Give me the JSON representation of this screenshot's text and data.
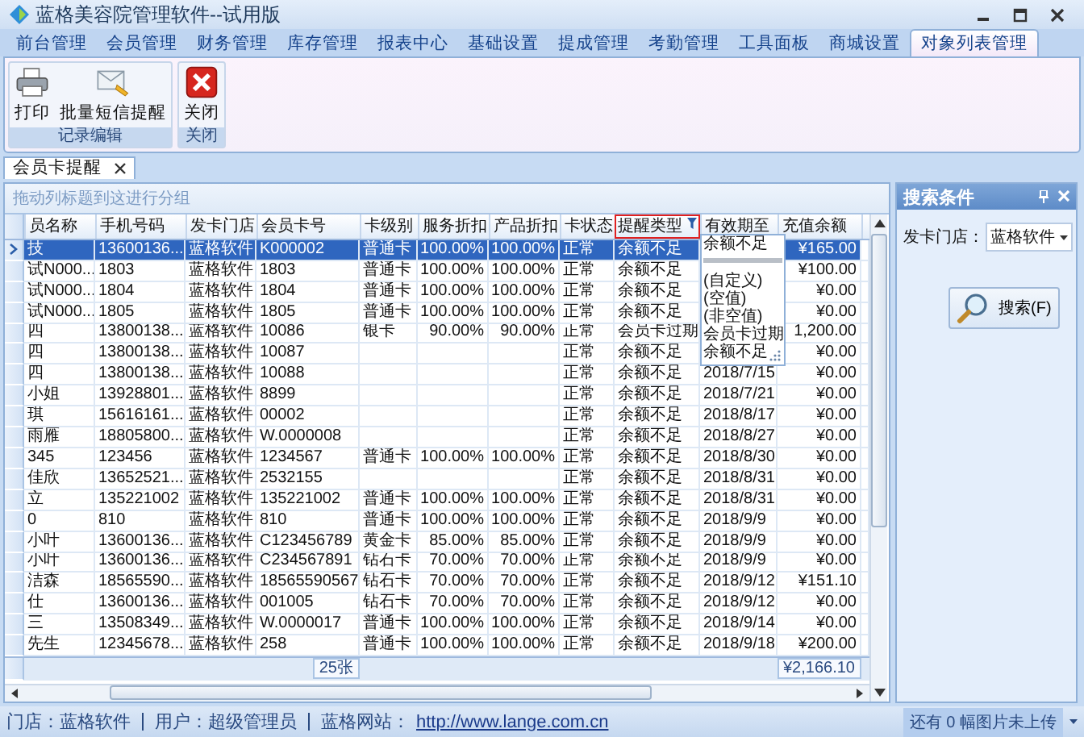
{
  "window": {
    "title": "蓝格美容院管理软件--试用版"
  },
  "tabs": [
    {
      "label": "前台管理",
      "selected": false
    },
    {
      "label": "会员管理",
      "selected": false
    },
    {
      "label": "财务管理",
      "selected": false
    },
    {
      "label": "库存管理",
      "selected": false
    },
    {
      "label": "报表中心",
      "selected": false
    },
    {
      "label": "基础设置",
      "selected": false
    },
    {
      "label": "提成管理",
      "selected": false
    },
    {
      "label": "考勤管理",
      "selected": false
    },
    {
      "label": "工具面板",
      "selected": false
    },
    {
      "label": "商城设置",
      "selected": false
    },
    {
      "label": "对象列表管理",
      "selected": true
    }
  ],
  "ribbon": [
    {
      "title": "记录编辑",
      "buttons": [
        {
          "label": "打印",
          "kind": "print"
        },
        {
          "label": "批量短信提醒",
          "kind": "sms"
        }
      ]
    },
    {
      "title": "关闭",
      "buttons": [
        {
          "label": "关闭",
          "kind": "close"
        }
      ]
    }
  ],
  "document_tab": {
    "label": "会员卡提醒"
  },
  "grid": {
    "group_hint": "拖动列标题到这进行分组",
    "columns": [
      {
        "label": "员名称",
        "filtered": false
      },
      {
        "label": "手机号码",
        "filtered": false
      },
      {
        "label": "发卡门店",
        "filtered": false
      },
      {
        "label": "会员卡号",
        "filtered": false
      },
      {
        "label": "卡级别",
        "filtered": false
      },
      {
        "label": "服务折扣",
        "filtered": false
      },
      {
        "label": "产品折扣",
        "filtered": false
      },
      {
        "label": "卡状态",
        "filtered": false
      },
      {
        "label": "提醒类型",
        "filtered": true
      },
      {
        "label": "有效期至",
        "filtered": false
      },
      {
        "label": "充值余额",
        "filtered": false
      }
    ],
    "rows": [
      {
        "selected": true,
        "name": "技",
        "phone": "13600136...",
        "store": "蓝格软件",
        "card_no": "K000002",
        "card_level": "普通卡",
        "service_discount": "100.00%",
        "product_discount": "100.00%",
        "card_status": "正常",
        "reminder_type": "余额不足",
        "balance": "¥165.00"
      },
      {
        "selected": false,
        "name": "试N000...",
        "phone": "1803",
        "store": "蓝格软件",
        "card_no": "1803",
        "card_level": "普通卡",
        "service_discount": "100.00%",
        "product_discount": "100.00%",
        "card_status": "正常",
        "reminder_type": "余额不足",
        "balance": "¥100.00"
      },
      {
        "selected": false,
        "name": "试N000...",
        "phone": "1804",
        "store": "蓝格软件",
        "card_no": "1804",
        "card_level": "普通卡",
        "service_discount": "100.00%",
        "product_discount": "100.00%",
        "card_status": "正常",
        "reminder_type": "余额不足",
        "balance": "¥0.00"
      },
      {
        "selected": false,
        "name": "试N000...",
        "phone": "1805",
        "store": "蓝格软件",
        "card_no": "1805",
        "card_level": "普通卡",
        "service_discount": "100.00%",
        "product_discount": "100.00%",
        "card_status": "正常",
        "reminder_type": "余额不足",
        "balance": "¥0.00"
      },
      {
        "selected": false,
        "name": "四",
        "phone": "13800138...",
        "store": "蓝格软件",
        "card_no": "10086",
        "card_level": "银卡",
        "service_discount": "90.00%",
        "product_discount": "90.00%",
        "card_status": "正常",
        "reminder_type": "会员卡过期",
        "balance": "1,200.00"
      },
      {
        "selected": false,
        "name": "四",
        "phone": "13800138...",
        "store": "蓝格软件",
        "card_no": "10087",
        "card_status": "正常",
        "reminder_type": "余额不足",
        "balance": "¥0.00"
      },
      {
        "selected": false,
        "name": "四",
        "phone": "13800138...",
        "store": "蓝格软件",
        "card_no": "10088",
        "card_status": "正常",
        "reminder_type": "余额不足",
        "expiry": "2018/7/15",
        "balance": "¥0.00"
      },
      {
        "selected": false,
        "name": "小姐",
        "phone": "13928801...",
        "store": "蓝格软件",
        "card_no": "8899",
        "card_status": "正常",
        "reminder_type": "余额不足",
        "expiry": "2018/7/21",
        "balance": "¥0.00"
      },
      {
        "selected": false,
        "name": "琪",
        "phone": "15616161...",
        "store": "蓝格软件",
        "card_no": "00002",
        "card_status": "正常",
        "reminder_type": "余额不足",
        "expiry": "2018/8/17",
        "balance": "¥0.00"
      },
      {
        "selected": false,
        "name": "雨雁",
        "phone": "18805800...",
        "store": "蓝格软件",
        "card_no": "W.0000008",
        "card_status": "正常",
        "reminder_type": "余额不足",
        "expiry": "2018/8/27",
        "balance": "¥0.00"
      },
      {
        "selected": false,
        "name": "345",
        "phone": "123456",
        "store": "蓝格软件",
        "card_no": "1234567",
        "card_level": "普通卡",
        "service_discount": "100.00%",
        "product_discount": "100.00%",
        "card_status": "正常",
        "reminder_type": "余额不足",
        "expiry": "2018/8/30",
        "balance": "¥0.00"
      },
      {
        "selected": false,
        "name": "佳欣",
        "phone": "13652521...",
        "store": "蓝格软件",
        "card_no": "2532155",
        "card_status": "正常",
        "reminder_type": "余额不足",
        "expiry": "2018/8/31",
        "balance": "¥0.00"
      },
      {
        "selected": false,
        "name": "立",
        "phone": "135221002",
        "store": "蓝格软件",
        "card_no": "135221002",
        "card_level": "普通卡",
        "service_discount": "100.00%",
        "product_discount": "100.00%",
        "card_status": "正常",
        "reminder_type": "余额不足",
        "expiry": "2018/8/31",
        "balance": "¥0.00"
      },
      {
        "selected": false,
        "name": "0",
        "phone": "810",
        "store": "蓝格软件",
        "card_no": "810",
        "card_level": "普通卡",
        "service_discount": "100.00%",
        "product_discount": "100.00%",
        "card_status": "正常",
        "reminder_type": "余额不足",
        "expiry": "2018/9/9",
        "balance": "¥0.00"
      },
      {
        "selected": false,
        "name": "小叶",
        "phone": "13600136...",
        "store": "蓝格软件",
        "card_no": "C123456789",
        "card_level": "黄金卡",
        "service_discount": "85.00%",
        "product_discount": "85.00%",
        "card_status": "正常",
        "reminder_type": "余额不足",
        "expiry": "2018/9/9",
        "balance": "¥0.00"
      },
      {
        "selected": false,
        "name": "小叶",
        "phone": "13600136...",
        "store": "蓝格软件",
        "card_no": "C234567891",
        "card_level": "钻石卡",
        "service_discount": "70.00%",
        "product_discount": "70.00%",
        "card_status": "正常",
        "reminder_type": "余额不足",
        "expiry": "2018/9/9",
        "balance": "¥0.00"
      },
      {
        "selected": false,
        "name": "洁森",
        "phone": "18565590...",
        "store": "蓝格软件",
        "card_no": "18565590567",
        "card_level": "钻石卡",
        "service_discount": "70.00%",
        "product_discount": "70.00%",
        "card_status": "正常",
        "reminder_type": "余额不足",
        "expiry": "2018/9/12",
        "balance": "¥151.10"
      },
      {
        "selected": false,
        "name": "仕",
        "phone": "13600136...",
        "store": "蓝格软件",
        "card_no": "001005",
        "card_level": "钻石卡",
        "service_discount": "70.00%",
        "product_discount": "70.00%",
        "card_status": "正常",
        "reminder_type": "余额不足",
        "expiry": "2018/9/12",
        "balance": "¥0.00"
      },
      {
        "selected": false,
        "name": "三",
        "phone": "13508349...",
        "store": "蓝格软件",
        "card_no": "W.0000017",
        "card_level": "普通卡",
        "service_discount": "100.00%",
        "product_discount": "100.00%",
        "card_status": "正常",
        "reminder_type": "余额不足",
        "expiry": "2018/9/14",
        "balance": "¥0.00"
      },
      {
        "selected": false,
        "name": "先生",
        "phone": "12345678...",
        "store": "蓝格软件",
        "card_no": "258",
        "card_level": "普通卡",
        "service_discount": "100.00%",
        "product_discount": "100.00%",
        "card_status": "正常",
        "reminder_type": "余额不足",
        "expiry": "2018/9/18",
        "balance": "¥200.00"
      }
    ],
    "summary": {
      "card_count": "25张",
      "balance_total": "¥2,166.10"
    },
    "filter_popup": {
      "value": "余额不足",
      "options": [
        "(自定义)",
        "(空值)",
        "(非空值)",
        "会员卡过期",
        "余额不足"
      ]
    }
  },
  "search_panel": {
    "title": "搜索条件",
    "field_label": "发卡门店：",
    "field_value": "蓝格软件",
    "button": "搜索(F)"
  },
  "status_bar": {
    "store": "门店：蓝格软件",
    "user": "用户：超级管理员",
    "website_label": "蓝格网站：",
    "website": "http://www.lange.com.cn",
    "upload_note": "还有 0 幅图片未上传"
  }
}
